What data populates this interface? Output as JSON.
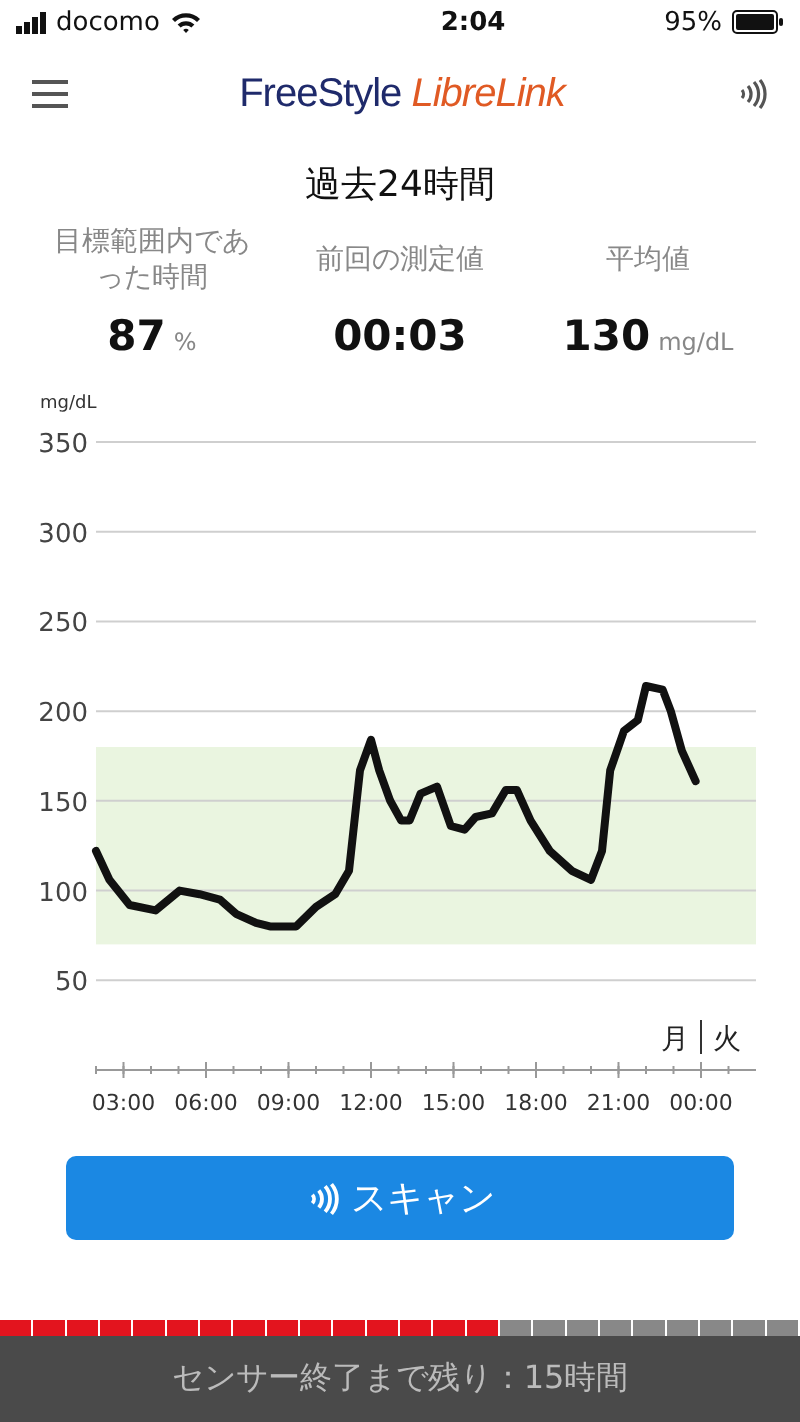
{
  "status_bar": {
    "carrier": "docomo",
    "time": "2:04",
    "battery": "95%"
  },
  "header": {
    "logo": "FreeStyle *LibreLink*"
  },
  "title": "過去24時間",
  "stats": [
    {
      "label": "目標範囲内であった時間",
      "value": "87",
      "unit": "%"
    },
    {
      "label": "前回の測定値",
      "value": "00:03"
    },
    {
      "label": "平均値",
      "value": "130",
      "unit": "mg/dL"
    }
  ],
  "chart": {
    "day_labels": [
      "月",
      "火"
    ],
    "chart_data": {
      "type": "line",
      "ylabel": "mg/dL",
      "xlim": [
        2,
        26
      ],
      "ylim": [
        0,
        350
      ],
      "grid": true,
      "yticks": [
        50,
        100,
        150,
        200,
        250,
        300,
        350
      ],
      "xticks": [
        {
          "value": 3,
          "label": "03:00"
        },
        {
          "value": 6,
          "label": "06:00"
        },
        {
          "value": 9,
          "label": "09:00"
        },
        {
          "value": 12,
          "label": "12:00"
        },
        {
          "value": 15,
          "label": "15:00"
        },
        {
          "value": 18,
          "label": "18:00"
        },
        {
          "value": 21,
          "label": "21:00"
        },
        {
          "value": 24,
          "label": "00:00"
        }
      ],
      "x": [
        2.0,
        2.49,
        3.22,
        4.17,
        5.04,
        5.77,
        6.5,
        7.09,
        7.82,
        8.33,
        9.28,
        10.0,
        10.7,
        11.2,
        11.6,
        12.0,
        12.3,
        12.7,
        13.1,
        13.4,
        13.8,
        14.4,
        14.9,
        15.4,
        15.8,
        16.4,
        16.9,
        17.3,
        17.8,
        18.5,
        19.3,
        20.0,
        20.4,
        20.7,
        21.2,
        21.7,
        22.0,
        22.6,
        22.9,
        23.3,
        23.8
      ],
      "series": [
        {
          "color": "#111111",
          "values": [
            122,
            106,
            92,
            89,
            100,
            98,
            95,
            87,
            82,
            80,
            80,
            91,
            98,
            111,
            167,
            184,
            167,
            150,
            139,
            139,
            154,
            158,
            136,
            134,
            141,
            143,
            156,
            156,
            139,
            122,
            111,
            106,
            122,
            167,
            189,
            195,
            214,
            212,
            200,
            178,
            161
          ]
        }
      ],
      "bands": [
        {
          "axis": "y",
          "from": 70,
          "to": 180
        }
      ]
    }
  },
  "scan_button": {
    "label": "スキャン"
  },
  "sensor": {
    "level": 0.625,
    "text": "センサー終了まで残り：15時間"
  }
}
